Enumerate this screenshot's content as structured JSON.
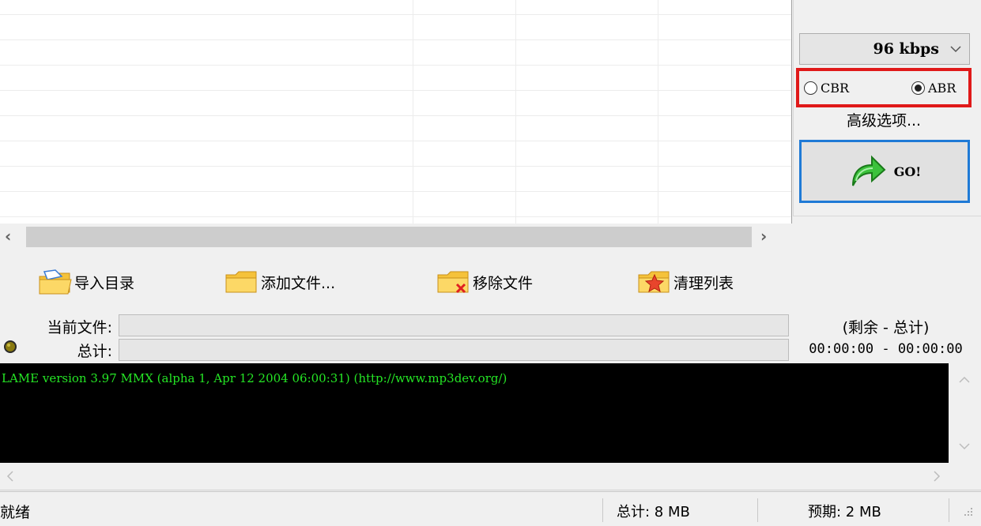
{
  "toolbar": {
    "import_dir": "导入目录",
    "add_files": "添加文件...",
    "remove_files": "移除文件",
    "clear_list": "清理列表"
  },
  "encoder": {
    "bitrate": "96 kbps",
    "cbr_label": "CBR",
    "abr_label": "ABR",
    "selected_mode": "ABR",
    "advanced_label": "高级选项...",
    "go_label": "GO!"
  },
  "progress": {
    "current_file_label": "当前文件:",
    "total_label": "总计:",
    "time_header": "(剩余 - 总计)",
    "time_value": "00:00:00 - 00:00:00",
    "current_percent": 0,
    "total_percent": 0
  },
  "console": {
    "line1": "LAME version 3.97 MMX (alpha 1, Apr 12 2004 06:00:31) (http://www.mp3dev.org/)"
  },
  "status": {
    "state": "就绪",
    "total": "总计: 8 MB",
    "estimate": "预期: 2 MB"
  },
  "colors": {
    "console_bg": "#000000",
    "console_text": "#25e525",
    "highlight_red": "#e01919",
    "highlight_blue": "#1f7ad6"
  }
}
